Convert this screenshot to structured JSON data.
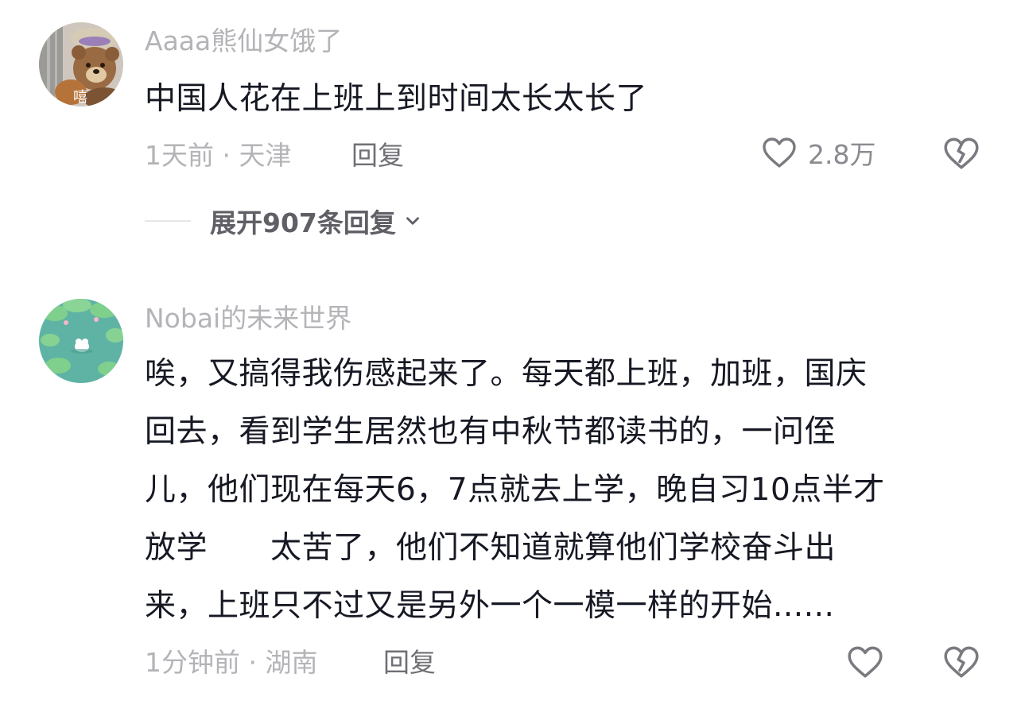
{
  "comments": [
    {
      "username": "Aaaa熊仙女饿了",
      "text": "中国人花在上班上到时间太长太长了",
      "time": "1天前",
      "separator": " · ",
      "location": "天津",
      "reply_label": "回复",
      "like_count": "2.8万",
      "expand_label": "展开907条回复",
      "avatar_icon": "teddy-bear-avatar",
      "avatar_badge": "嘻"
    },
    {
      "username": "Nobai的未来世界",
      "text_lines": [
        "唉，又搞得我伤感起来了。每天都上班，加班，国庆",
        "回去，看到学生居然也有中秋节都读书的，一问侄",
        "儿，他们现在每天6，7点就去上学，晚自习10点半才",
        "放学　　太苦了，他们不知道就算他们学校奋斗出",
        "来，上班只不过又是另外一个一模一样的开始......"
      ],
      "time": "1分钟前",
      "separator": " · ",
      "location": "湖南",
      "reply_label": "回复",
      "avatar_icon": "lily-pond-avatar"
    }
  ],
  "colors": {
    "username": "#b4b4b8",
    "body": "#161823",
    "meta": "#b4b4b8",
    "reply": "#6f6f76",
    "icon": "#7a7a80"
  },
  "icons": {
    "like": "heart-icon",
    "dislike": "broken-heart-icon",
    "expand": "chevron-down-icon"
  }
}
